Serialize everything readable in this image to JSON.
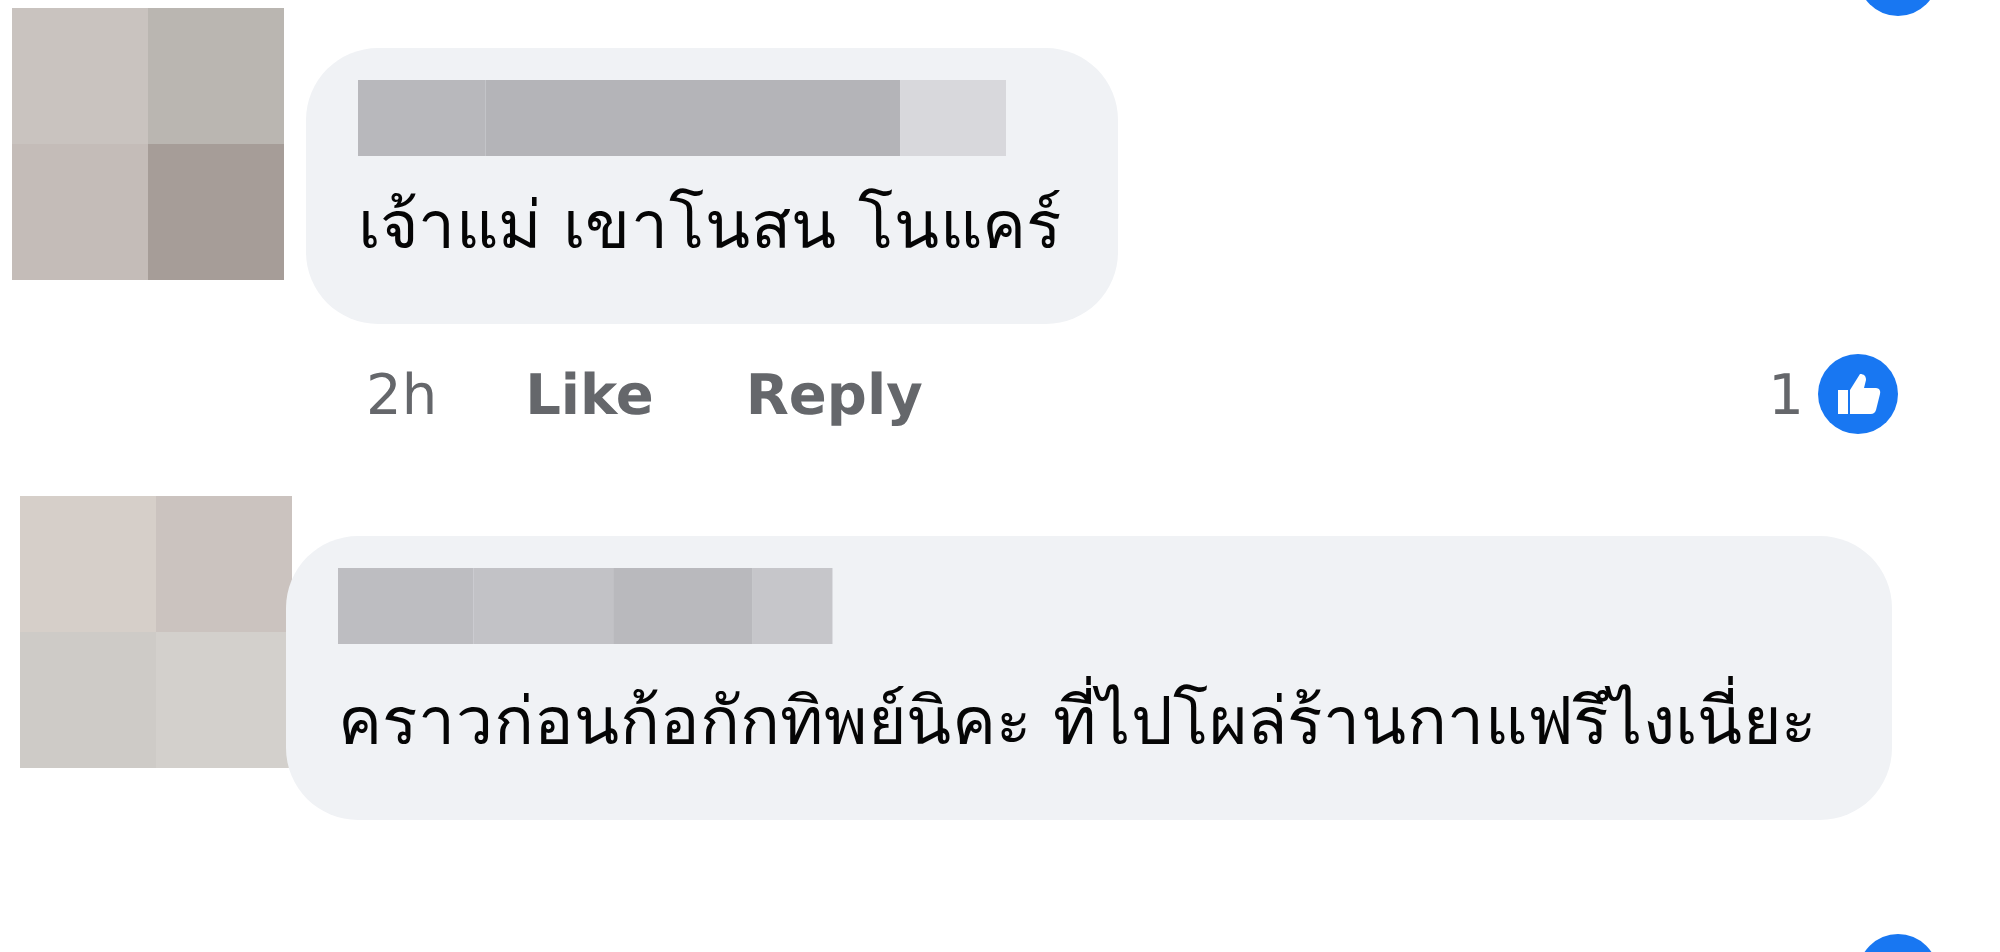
{
  "comments": [
    {
      "text": "เจ้าแม่ เขาโนสน โนแคร์",
      "time": "2h",
      "actions": [
        "Like",
        "Reply"
      ],
      "reaction_count": "1"
    },
    {
      "text": "คราวก่อนก้อกักทิพย์นิคะ ที่ไปโผล่ร้านกาแฟรึไงเนี่ยะ"
    }
  ]
}
